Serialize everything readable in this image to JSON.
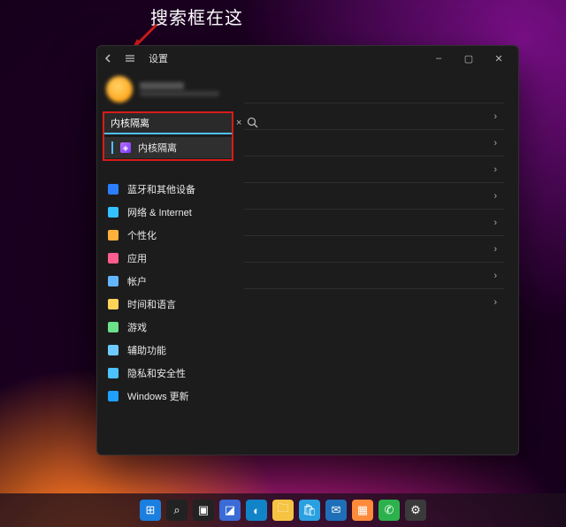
{
  "annotation": {
    "text": "搜索框在这"
  },
  "window": {
    "title": "设置",
    "controls": {
      "min": "–",
      "max": "▢",
      "close": "✕"
    }
  },
  "search": {
    "value": "内核隔离",
    "clear_label": "×",
    "suggestion": {
      "label": "内核隔离"
    }
  },
  "sidebar": {
    "items": [
      {
        "icon": "bluetooth",
        "color": "#2b7fff",
        "label": "蓝牙和其他设备"
      },
      {
        "icon": "network",
        "color": "#33c1ff",
        "label": "网络 & Internet"
      },
      {
        "icon": "personal",
        "color": "#ffb03a",
        "label": "个性化"
      },
      {
        "icon": "apps",
        "color": "#ff5d8f",
        "label": "应用"
      },
      {
        "icon": "accounts",
        "color": "#64b5ff",
        "label": "帐户"
      },
      {
        "icon": "time",
        "color": "#ffd25a",
        "label": "时间和语言"
      },
      {
        "icon": "gaming",
        "color": "#6de08a",
        "label": "游戏"
      },
      {
        "icon": "access",
        "color": "#6ecbff",
        "label": "辅助功能"
      },
      {
        "icon": "privacy",
        "color": "#4cc2ff",
        "label": "隐私和安全性"
      },
      {
        "icon": "update",
        "color": "#1fa0ff",
        "label": "Windows 更新"
      }
    ]
  },
  "content": {
    "rows": 8,
    "chevron": "›"
  },
  "taskbar": {
    "items": [
      {
        "name": "start",
        "glyph": "⊞",
        "bg": "#1b7fe0"
      },
      {
        "name": "search",
        "glyph": "⌕",
        "bg": "#222222"
      },
      {
        "name": "taskview",
        "glyph": "▣",
        "bg": "#222222"
      },
      {
        "name": "widgets",
        "glyph": "◪",
        "bg": "#3a6bd6"
      },
      {
        "name": "edge",
        "glyph": "◐",
        "bg": "#1184c8"
      },
      {
        "name": "explorer",
        "glyph": "🗀",
        "bg": "#f6c443"
      },
      {
        "name": "store",
        "glyph": "🛍",
        "bg": "#2aa0e0"
      },
      {
        "name": "mail",
        "glyph": "✉",
        "bg": "#1e6fb8"
      },
      {
        "name": "calendar",
        "glyph": "▦",
        "bg": "#ff8a3a"
      },
      {
        "name": "wechat",
        "glyph": "✆",
        "bg": "#2bb24c"
      },
      {
        "name": "settings",
        "glyph": "⚙",
        "bg": "#3a3a3a"
      }
    ]
  }
}
